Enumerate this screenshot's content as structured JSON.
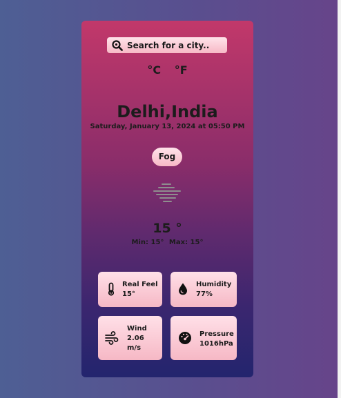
{
  "search": {
    "placeholder": "Search for a city.."
  },
  "units": {
    "celsius": "°C",
    "fahrenheit": "°F"
  },
  "location": {
    "city": "Delhi,India",
    "datetime": "Saturday, January 13, 2024 at 05:50 PM"
  },
  "weather": {
    "condition": "Fog",
    "icon": "fog-icon",
    "temperature": "15 °",
    "min": "Min: 15°",
    "max": "Max: 15°"
  },
  "details": {
    "real_feel": {
      "label": "Real Feel",
      "value": "15°",
      "icon": "thermometer-icon"
    },
    "humidity": {
      "label": "Humidity",
      "value": "77%",
      "icon": "droplet-icon"
    },
    "wind": {
      "label": "Wind",
      "value_line1": "2.06",
      "value_line2": "m/s",
      "icon": "wind-icon"
    },
    "pressure": {
      "label": "Pressure",
      "value": "1016hPa",
      "icon": "gauge-icon"
    }
  },
  "colors": {
    "card_top": "#c2386a",
    "card_bottom": "#23256e",
    "pill_light": "#ffe3ea",
    "pill_dark": "#f7b9c6",
    "text": "#1c1c1c"
  }
}
